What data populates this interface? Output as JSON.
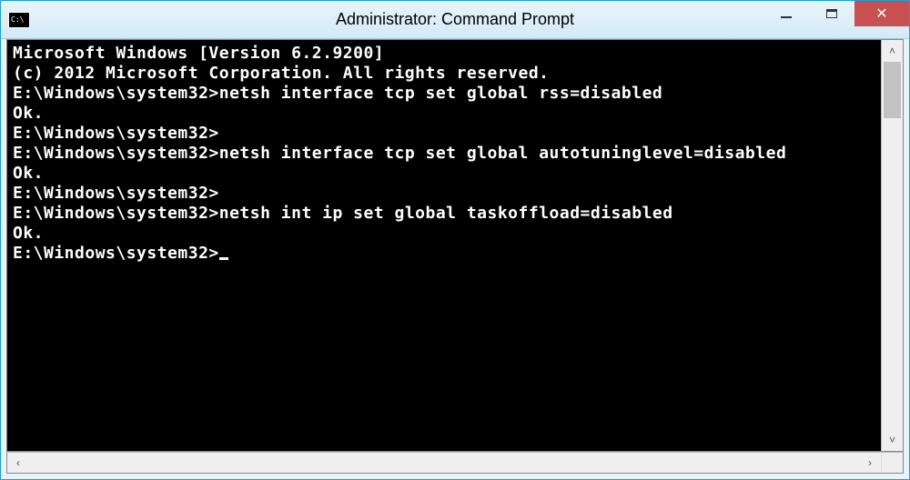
{
  "window": {
    "title": "Administrator: Command Prompt"
  },
  "console": {
    "header1": "Microsoft Windows [Version 6.2.9200]",
    "header2": "(c) 2012 Microsoft Corporation. All rights reserved.",
    "blank": "",
    "prompt": "E:\\Windows\\system32>",
    "cmd1": "netsh interface tcp set global rss=disabled",
    "ok": "Ok.",
    "cmd2": "netsh interface tcp set global autotuninglevel=disabled",
    "cmd3": "netsh int ip set global taskoffload=disabled"
  }
}
